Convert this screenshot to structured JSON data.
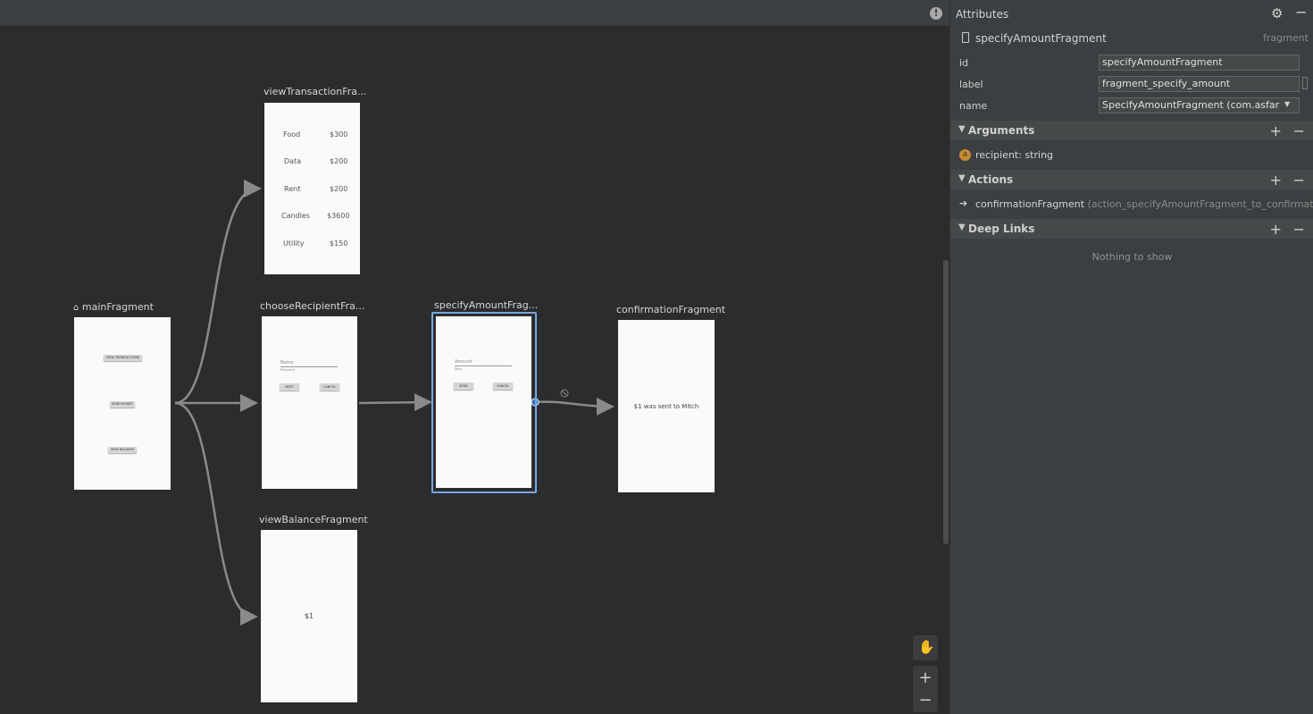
{
  "editor": {
    "fragments": {
      "main": {
        "label": "mainFragment",
        "buttons": [
          "VIEW TRANSACTIONS",
          "SEND MONEY",
          "VIEW BALANCE"
        ]
      },
      "view_transaction": {
        "label": "viewTransactionFra...",
        "rows": [
          {
            "name": "Food",
            "amount": "$300"
          },
          {
            "name": "Data",
            "amount": "$200"
          },
          {
            "name": "Rent",
            "amount": "$200"
          },
          {
            "name": "Candles",
            "amount": "$3600"
          },
          {
            "name": "Utility",
            "amount": "$150"
          }
        ]
      },
      "choose_recipient": {
        "label": "chooseRecipientFra...",
        "field_hint": "Name",
        "field_sub": "Recipient",
        "next": "NEXT",
        "cancel": "CANCEL"
      },
      "specify_amount": {
        "label": "specifyAmountFrag...",
        "field_hint": "Amount",
        "field_sub": "$ksh",
        "send": "SEND",
        "cancel": "CANCEL"
      },
      "confirmation": {
        "label": "confirmationFragment",
        "message": "$1 was sent to Mitch"
      },
      "view_balance": {
        "label": "viewBalanceFragment",
        "value": "$1"
      }
    },
    "tools": {
      "pan_icon": "hand-icon",
      "zoom_in": "+",
      "zoom_out": "−"
    }
  },
  "panel": {
    "title": "Attributes",
    "selected": {
      "name": "specifyAmountFragment",
      "type": "fragment"
    },
    "attributes": [
      {
        "label": "id",
        "value": "specifyAmountFragment"
      },
      {
        "label": "label",
        "value": "fragment_specify_amount"
      },
      {
        "label": "name",
        "value": "SpecifyAmountFragment (com.asfar"
      }
    ],
    "arguments": {
      "title": "Arguments",
      "items": [
        {
          "badge": "a",
          "text": "recipient: string"
        }
      ]
    },
    "actions": {
      "title": "Actions",
      "items": [
        {
          "destination": "confirmationFragment",
          "action": "(action_specifyAmountFragment_to_confirmatio"
        }
      ]
    },
    "deep_links": {
      "title": "Deep Links",
      "empty": "Nothing to show"
    }
  },
  "colors": {
    "selection": "#7aa7e0",
    "arrow": "#8a8a8a",
    "argument_badge": "#c58a2e"
  }
}
